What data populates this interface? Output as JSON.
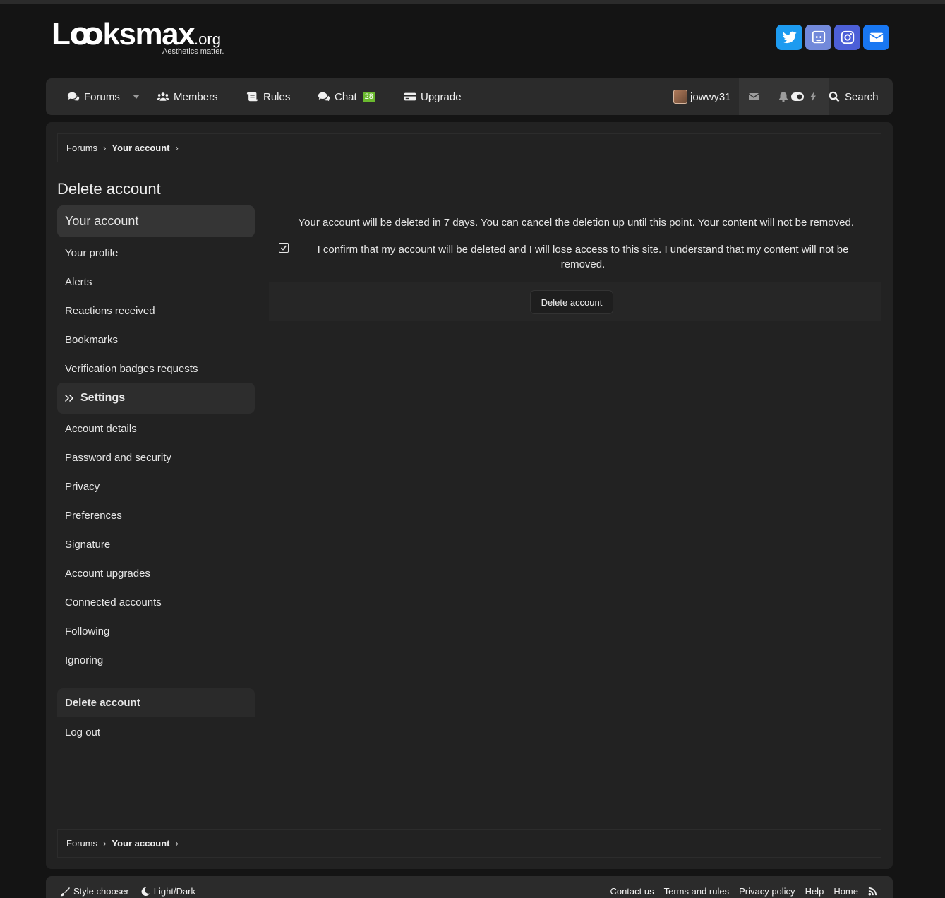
{
  "header": {
    "logo_main": "Lꝏksmax",
    "logo_tld": ".org",
    "logo_tagline": "Aesthetics matter.",
    "social": [
      {
        "icon": "twitter-icon",
        "color": "#1d9bf0"
      },
      {
        "icon": "discord-icon",
        "color": "#7289da"
      },
      {
        "icon": "instagram-icon",
        "color": "#4c5fd7"
      },
      {
        "icon": "mail-icon",
        "color": "#1877f2"
      }
    ]
  },
  "nav": {
    "forums": "Forums",
    "members": "Members",
    "rules": "Rules",
    "chat": "Chat",
    "chat_badge": "28",
    "upgrade": "Upgrade",
    "username": "jowwy31",
    "search": "Search"
  },
  "breadcrumb": {
    "root": "Forums",
    "current": "Your account"
  },
  "page_title": "Delete account",
  "sidebar": {
    "group_title": "Your account",
    "items": [
      "Your profile",
      "Alerts",
      "Reactions received",
      "Bookmarks",
      "Verification badges requests"
    ],
    "settings_title": "Settings",
    "settings_items": [
      "Account details",
      "Password and security",
      "Privacy",
      "Preferences",
      "Signature",
      "Account upgrades",
      "Connected accounts",
      "Following",
      "Ignoring"
    ],
    "active_item": "Delete account",
    "logout": "Log out"
  },
  "main": {
    "notice": "Your account will be deleted in 7 days. You can cancel the deletion up until this point. Your content will not be removed.",
    "confirm_text": "I confirm that my account will be deleted and I will lose access to this site. I understand that my content will not be removed.",
    "confirm_checked": true,
    "delete_button": "Delete account"
  },
  "footer": {
    "style_chooser": "Style chooser",
    "light_dark": "Light/Dark",
    "links": [
      "Contact us",
      "Terms and rules",
      "Privacy policy",
      "Help",
      "Home"
    ]
  }
}
